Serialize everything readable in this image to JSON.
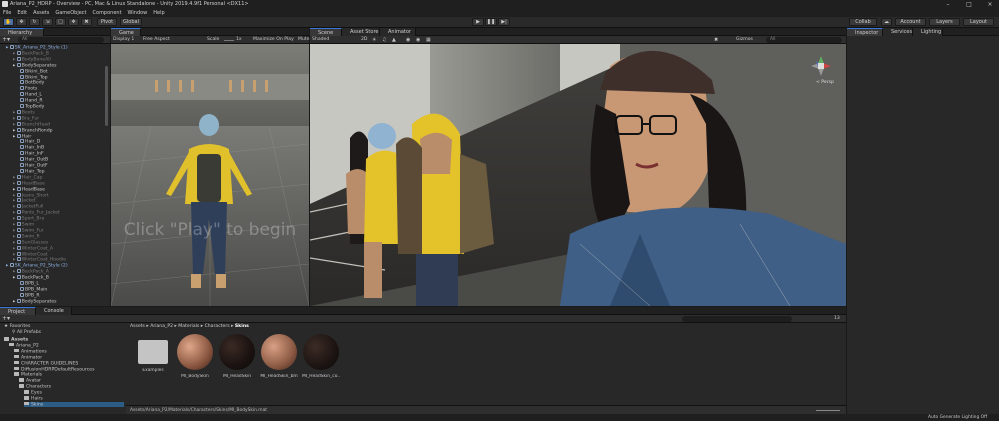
{
  "window": {
    "title": "Ariana_P2_HDRP - Overview - PC, Mac & Linux Standalone - Unity 2019.4.9f1 Personal <DX11>"
  },
  "menu": [
    "File",
    "Edit",
    "Assets",
    "GameObject",
    "Component",
    "Window",
    "Help"
  ],
  "toolbar": {
    "pivot": "Pivot",
    "global": "Global",
    "collab": "Collab",
    "account": "Account",
    "layers": "Layers",
    "layout": "Layout"
  },
  "hierarchy": {
    "tab": "Hierarchy",
    "search_placeholder": "All",
    "rows": [
      {
        "t": "SK_Ariana_P2_Style (1)",
        "c": "blue",
        "i": 0
      },
      {
        "t": "BackPack_B",
        "c": "dim",
        "i": 1
      },
      {
        "t": "BodyBoneAll",
        "c": "dim",
        "i": 1
      },
      {
        "t": "BodySeparates",
        "c": "",
        "i": 1
      },
      {
        "t": "Bikini_Bot",
        "c": "",
        "i": 2
      },
      {
        "t": "Bikini_Top",
        "c": "",
        "i": 2
      },
      {
        "t": "BotBody",
        "c": "",
        "i": 2
      },
      {
        "t": "Foots",
        "c": "",
        "i": 2
      },
      {
        "t": "Hand_L",
        "c": "",
        "i": 2
      },
      {
        "t": "Hand_R",
        "c": "",
        "i": 2
      },
      {
        "t": "TopBody",
        "c": "",
        "i": 2
      },
      {
        "t": "Boots",
        "c": "dim",
        "i": 1
      },
      {
        "t": "Bra_Fur",
        "c": "dim",
        "i": 1
      },
      {
        "t": "BranchHead",
        "c": "dim",
        "i": 1
      },
      {
        "t": "BranchRondp",
        "c": "",
        "i": 1
      },
      {
        "t": "Hair",
        "c": "",
        "i": 1
      },
      {
        "t": "Hair_D",
        "c": "",
        "i": 2
      },
      {
        "t": "Hair_InB",
        "c": "",
        "i": 2
      },
      {
        "t": "Hair_InF",
        "c": "",
        "i": 2
      },
      {
        "t": "Hair_OutB",
        "c": "",
        "i": 2
      },
      {
        "t": "Hair_OutF",
        "c": "",
        "i": 2
      },
      {
        "t": "Hair_Top",
        "c": "",
        "i": 2
      },
      {
        "t": "Hair_Cap",
        "c": "dim",
        "i": 1
      },
      {
        "t": "HeadBase",
        "c": "dim",
        "i": 1
      },
      {
        "t": "HeadBase",
        "c": "",
        "i": 1
      },
      {
        "t": "Jeans_Short",
        "c": "dim",
        "i": 1
      },
      {
        "t": "Jacket",
        "c": "dim",
        "i": 1
      },
      {
        "t": "JacketFull",
        "c": "dim",
        "i": 1
      },
      {
        "t": "Pants_Fur_Jacket",
        "c": "dim",
        "i": 1
      },
      {
        "t": "Sport_Bra",
        "c": "dim",
        "i": 1
      },
      {
        "t": "Swim",
        "c": "dim",
        "i": 1
      },
      {
        "t": "Swim_Fur",
        "c": "dim",
        "i": 1
      },
      {
        "t": "Swim_R",
        "c": "dim",
        "i": 1
      },
      {
        "t": "SunGlasses",
        "c": "dim",
        "i": 1
      },
      {
        "t": "WinterCoat_A",
        "c": "dim",
        "i": 1
      },
      {
        "t": "WinterCoat",
        "c": "dim",
        "i": 1
      },
      {
        "t": "WinterCoat_Hoodie",
        "c": "dim",
        "i": 1
      },
      {
        "t": "SK_Ariana_P2_Style (2)",
        "c": "blue",
        "i": 0
      },
      {
        "t": "BackPack_A",
        "c": "dim",
        "i": 1
      },
      {
        "t": "BackPack_B",
        "c": "",
        "i": 1
      },
      {
        "t": "BPB_L",
        "c": "",
        "i": 2
      },
      {
        "t": "BPB_Main",
        "c": "",
        "i": 2
      },
      {
        "t": "BPB_R",
        "c": "",
        "i": 2
      },
      {
        "t": "BodySeparates",
        "c": "",
        "i": 1
      }
    ]
  },
  "game": {
    "tab": "Game",
    "display": "Display 1",
    "aspect": "Free Aspect",
    "scale_label": "Scale",
    "scale_value": "1x",
    "maximize": "Maximize On Play",
    "mute": "Mute",
    "overlay": "Click \"Play\" to begin"
  },
  "scene": {
    "tabs": [
      "Scene",
      "Asset Store",
      "Animator"
    ],
    "shading": "Shaded",
    "mode": "2D",
    "gizmos": "Gizmos",
    "persp": "< Persp",
    "search": "All"
  },
  "inspector": {
    "tabs": [
      "Inspector",
      "Services",
      "Lighting"
    ]
  },
  "project": {
    "tabs": [
      "Project",
      "Console"
    ],
    "favorites": "Favorites",
    "all_prefabs": "All Prefabs",
    "breadcrumb": [
      "Assets",
      "Ariana_P2",
      "Materials",
      "Characters",
      "Skins"
    ],
    "tree": [
      {
        "t": "Assets",
        "i": 0,
        "b": true
      },
      {
        "t": "Ariana_P2",
        "i": 1
      },
      {
        "t": "Animations",
        "i": 2
      },
      {
        "t": "Animator",
        "i": 2
      },
      {
        "t": "CHARACTER GUIDELINES",
        "i": 2
      },
      {
        "t": "DiffusionHDRPDefaultResources",
        "i": 2
      },
      {
        "t": "Materials",
        "i": 2
      },
      {
        "t": "Avatar",
        "i": 3
      },
      {
        "t": "Characters",
        "i": 3
      },
      {
        "t": "Eyes",
        "i": 4
      },
      {
        "t": "Hairs",
        "i": 4
      },
      {
        "t": "Skins",
        "i": 4
      }
    ],
    "assets": [
      "Examples",
      "MI_BodySkin",
      "MI_HeadSkin",
      "MI_HeadSkin_bm",
      "MI_HeadSkin_co..."
    ],
    "footer_path": "Assets/Ariana_P2/Materials/Characters/Skins/MI_BodySkin.mat",
    "count": "13"
  },
  "status": {
    "right": "Auto Generate Lighting Off"
  },
  "colors": {
    "accent": "#3b78d6",
    "selection": "#2c5d87",
    "jacket_yellow": "#e3c22a"
  }
}
